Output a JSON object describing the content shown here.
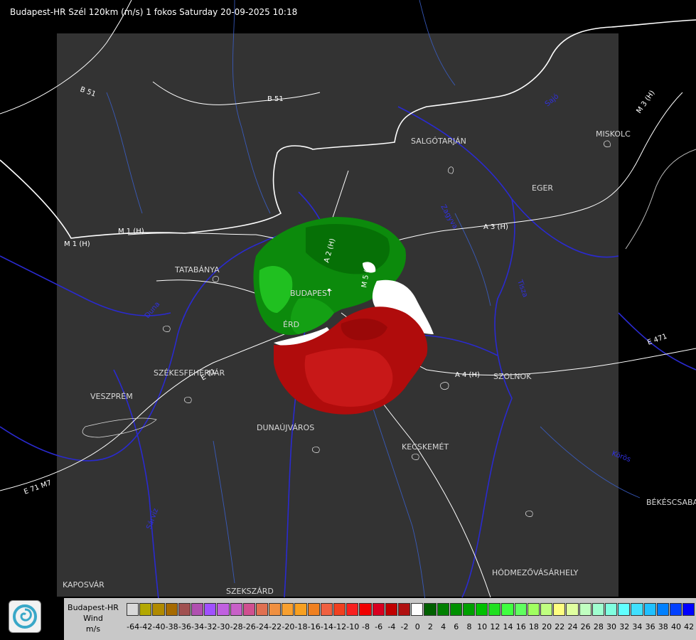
{
  "header": {
    "title": "Budapest-HR Szél 120km (m/s) 1 fokos Saturday 20-09-2025 10:18"
  },
  "map": {
    "cities": [
      "SALGÓTARJÁN",
      "MISKOLC",
      "EGER",
      "TATABÁNYA",
      "BUDAPEST",
      "ÉRD",
      "SZÉKESFEHÉRVÁR",
      "VESZPRÉM",
      "DUNAÚJVÁROS",
      "KECSKEMÉT",
      "SZOLNOK",
      "BÉKÉSCSABA",
      "HÓDMEZŐVÁSÁRHELY",
      "KAPOSVÁR",
      "SZEKSZÁRD"
    ],
    "roads": [
      "B 51",
      "B 51",
      "M 1 (H)",
      "M 3 (H)",
      "A 3 (H)",
      "M 1 (H)",
      "A 2 (H)",
      "M 5 (H)",
      "A 4 (H)",
      "E 71 M7",
      "E 71",
      "E 471"
    ],
    "rivers": [
      "Duna",
      "Tisza",
      "Zagyva",
      "Sajó",
      "Körös",
      "Sárvíz"
    ],
    "colors": {
      "background": "#000000",
      "radar_area": "#323232",
      "rivers": "#2525c8",
      "roads": "#ffffff",
      "border": "#ffffff",
      "lakes": "#d8d8d8"
    }
  },
  "legend": {
    "station": "Budapest-HR",
    "product": "Wind",
    "unit": "m/s",
    "ticks": [
      "-64",
      "-42",
      "-40",
      "-38",
      "-36",
      "-34",
      "-32",
      "-30",
      "-28",
      "-26",
      "-24",
      "-22",
      "-20",
      "-18",
      "-16",
      "-14",
      "-12",
      "-10",
      "-8",
      "-6",
      "-4",
      "-2",
      "0",
      "2",
      "4",
      "6",
      "8",
      "10",
      "12",
      "14",
      "16",
      "18",
      "20",
      "22",
      "24",
      "26",
      "28",
      "30",
      "32",
      "34",
      "36",
      "38",
      "40",
      "42"
    ],
    "colors": [
      "#d9d9d9",
      "#b3a800",
      "#b08a00",
      "#a66a00",
      "#a05050",
      "#b050b0",
      "#a050ff",
      "#c060e0",
      "#c860c8",
      "#d05090",
      "#e07050",
      "#f09040",
      "#f8a030",
      "#f8a020",
      "#f08020",
      "#f06040",
      "#f04020",
      "#f82020",
      "#f00000",
      "#d80020",
      "#c00000",
      "#b01010",
      "#ffffff",
      "#006000",
      "#008000",
      "#009000",
      "#00a000",
      "#00c000",
      "#20e020",
      "#40ff40",
      "#60ff60",
      "#a0ff60",
      "#c0ff80",
      "#ffff80",
      "#e0ffa0",
      "#c0ffc0",
      "#a0ffd0",
      "#80ffe0",
      "#60ffff",
      "#40e0ff",
      "#20c0ff",
      "#0080ff",
      "#0040ff",
      "#0000ff"
    ]
  }
}
